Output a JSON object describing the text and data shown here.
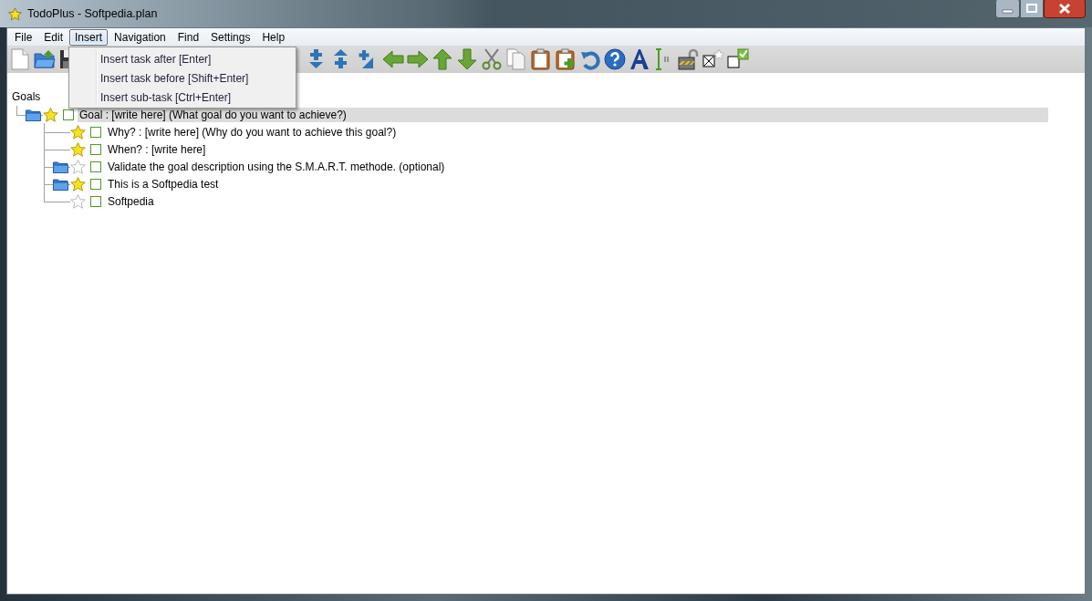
{
  "window": {
    "title": "TodoPlus - Softpedia.plan"
  },
  "menu_bar": [
    {
      "label": "File",
      "selected": false
    },
    {
      "label": "Edit",
      "selected": false
    },
    {
      "label": "Insert",
      "selected": true
    },
    {
      "label": "Navigation",
      "selected": false
    },
    {
      "label": "Find",
      "selected": false
    },
    {
      "label": "Settings",
      "selected": false
    },
    {
      "label": "Help",
      "selected": false
    }
  ],
  "open_menu": {
    "items": [
      "Insert task after [Enter]",
      "Insert task before [Shift+Enter]",
      "Insert sub-task [Ctrl+Enter]"
    ]
  },
  "tree": {
    "root": "Goals",
    "children": [
      {
        "text": "Goal : [write here] (What goal do you want to achieve?)",
        "folder": true,
        "starred": true,
        "checked": false,
        "selected": true,
        "children": [
          {
            "text": "Why? : [write here] (Why do you want to achieve this goal?)",
            "folder": false,
            "starred": true,
            "checked": false,
            "selected": false
          },
          {
            "text": "When? : [write here]",
            "folder": false,
            "starred": true,
            "checked": false,
            "selected": false
          },
          {
            "text": "Validate the goal description using the S.M.A.R.T. methode. (optional)",
            "folder": true,
            "starred": false,
            "checked": false,
            "selected": false
          },
          {
            "text": "This is a Softpedia test",
            "folder": true,
            "starred": true,
            "checked": false,
            "selected": false
          },
          {
            "text": "Softpedia",
            "folder": false,
            "starred": false,
            "checked": false,
            "selected": false
          }
        ]
      }
    ]
  }
}
